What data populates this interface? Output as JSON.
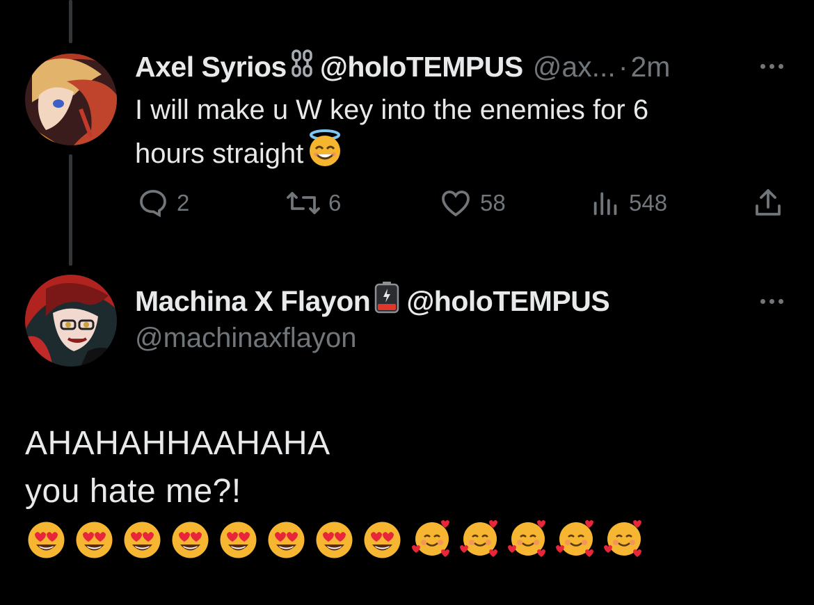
{
  "reply": {
    "author_name": "Axel Syrios",
    "badge_icon": "chain-icon",
    "affiliation_handle": "@holoTEMPUS",
    "handle": "@ax...",
    "separator": "·",
    "time": "2m",
    "text_line1": "I will make u W key into the enemies for 6",
    "text_line2": "hours straight",
    "text_emoji": "smiling-face-with-halo",
    "stats": {
      "replies": "2",
      "reposts": "6",
      "likes": "58",
      "views": "548"
    }
  },
  "main": {
    "author_name": "Machina X Flayon",
    "badge_icon": "low-battery-icon",
    "affiliation_handle": "@holoTEMPUS",
    "handle": "@machinaxflayon",
    "text_line1": "AHAHAHHAAHAHA",
    "text_line2": "you hate me?!",
    "emoji_row": [
      "heart-eyes",
      "heart-eyes",
      "heart-eyes",
      "heart-eyes",
      "heart-eyes",
      "heart-eyes",
      "heart-eyes",
      "heart-eyes",
      "smiling-face-with-hearts",
      "smiling-face-with-hearts",
      "smiling-face-with-hearts",
      "smiling-face-with-hearts",
      "smiling-face-with-hearts"
    ]
  },
  "colors": {
    "background": "#000000",
    "text": "#e7e9ea",
    "muted": "#71767b",
    "thread_line": "#333639"
  }
}
